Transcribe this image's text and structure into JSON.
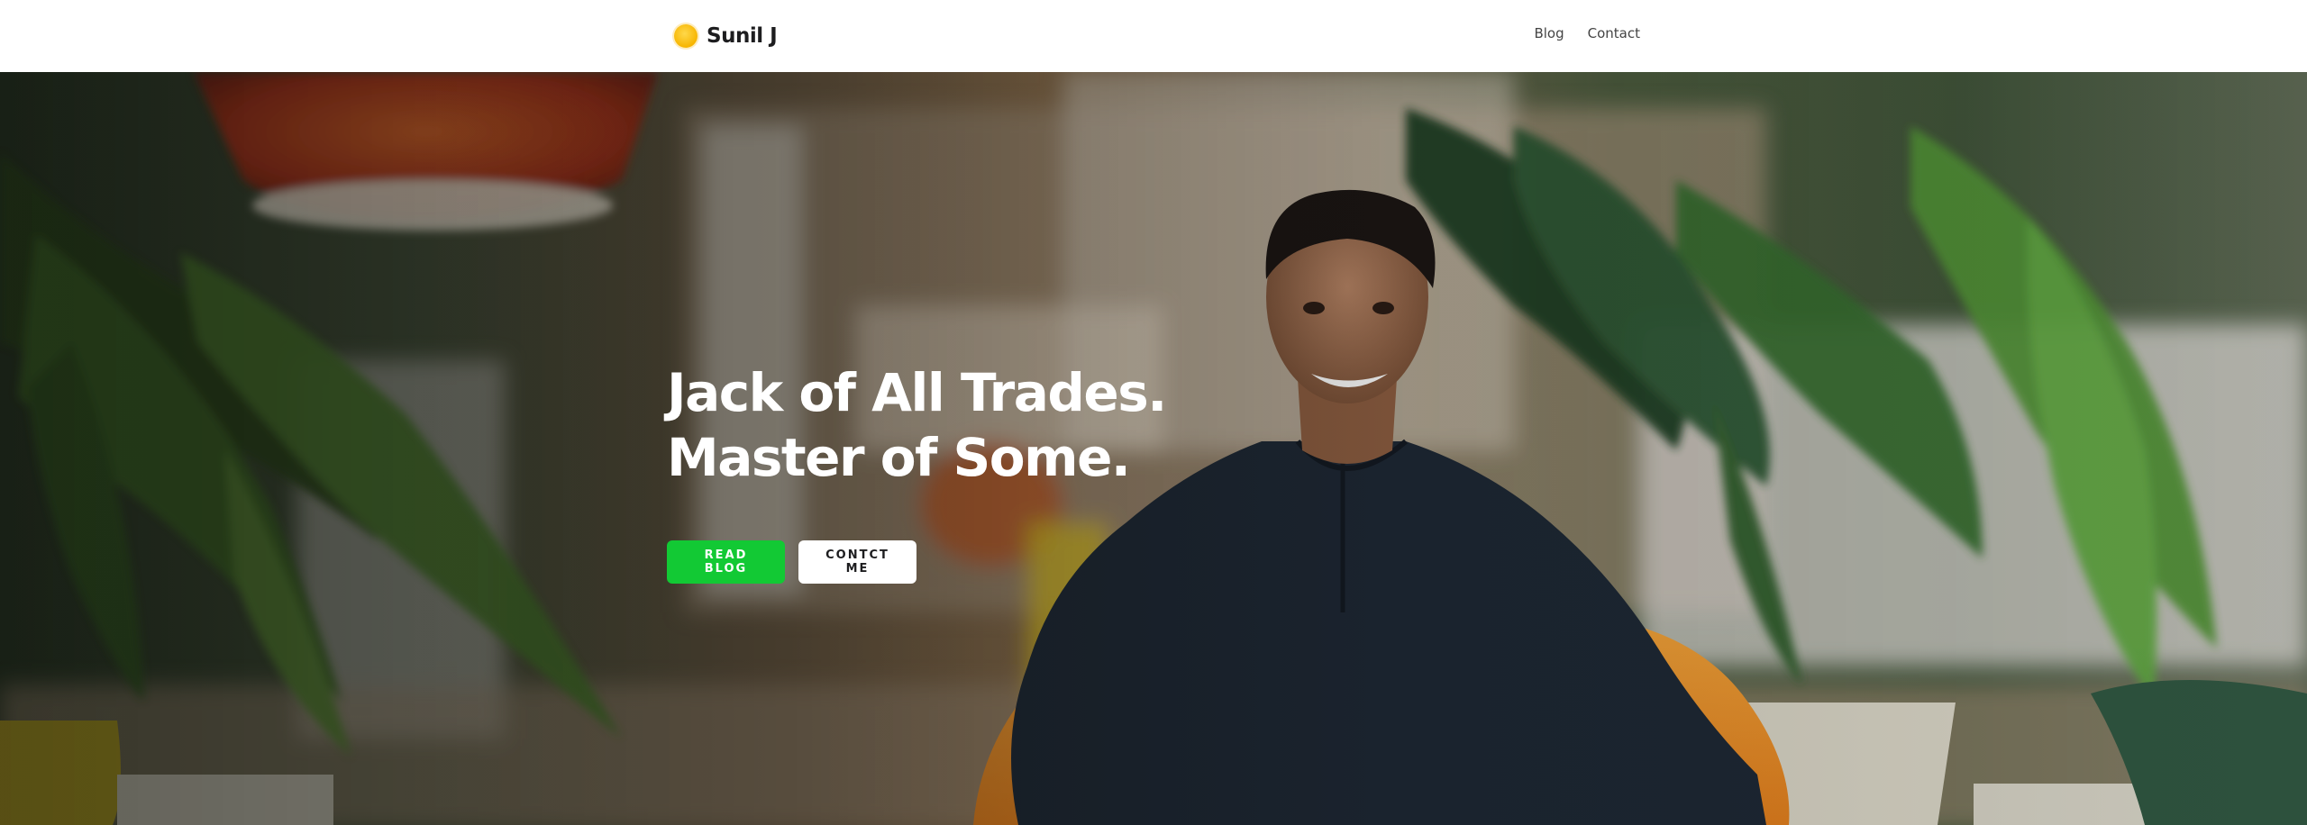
{
  "header": {
    "brand": {
      "name": "Sunil J",
      "icon": "sun-icon",
      "icon_color": "#f7b500"
    },
    "nav": [
      {
        "label": "Blog"
      },
      {
        "label": "Contact"
      }
    ]
  },
  "hero": {
    "headline_line1": "Jack of All Trades.",
    "headline_line2": "Master of Some.",
    "primary_button": {
      "label": "READ BLOG",
      "color": "#12c934"
    },
    "secondary_button": {
      "label": "CONTCT ME",
      "color": "#ffffff"
    },
    "background_image": "portrait-photo"
  }
}
